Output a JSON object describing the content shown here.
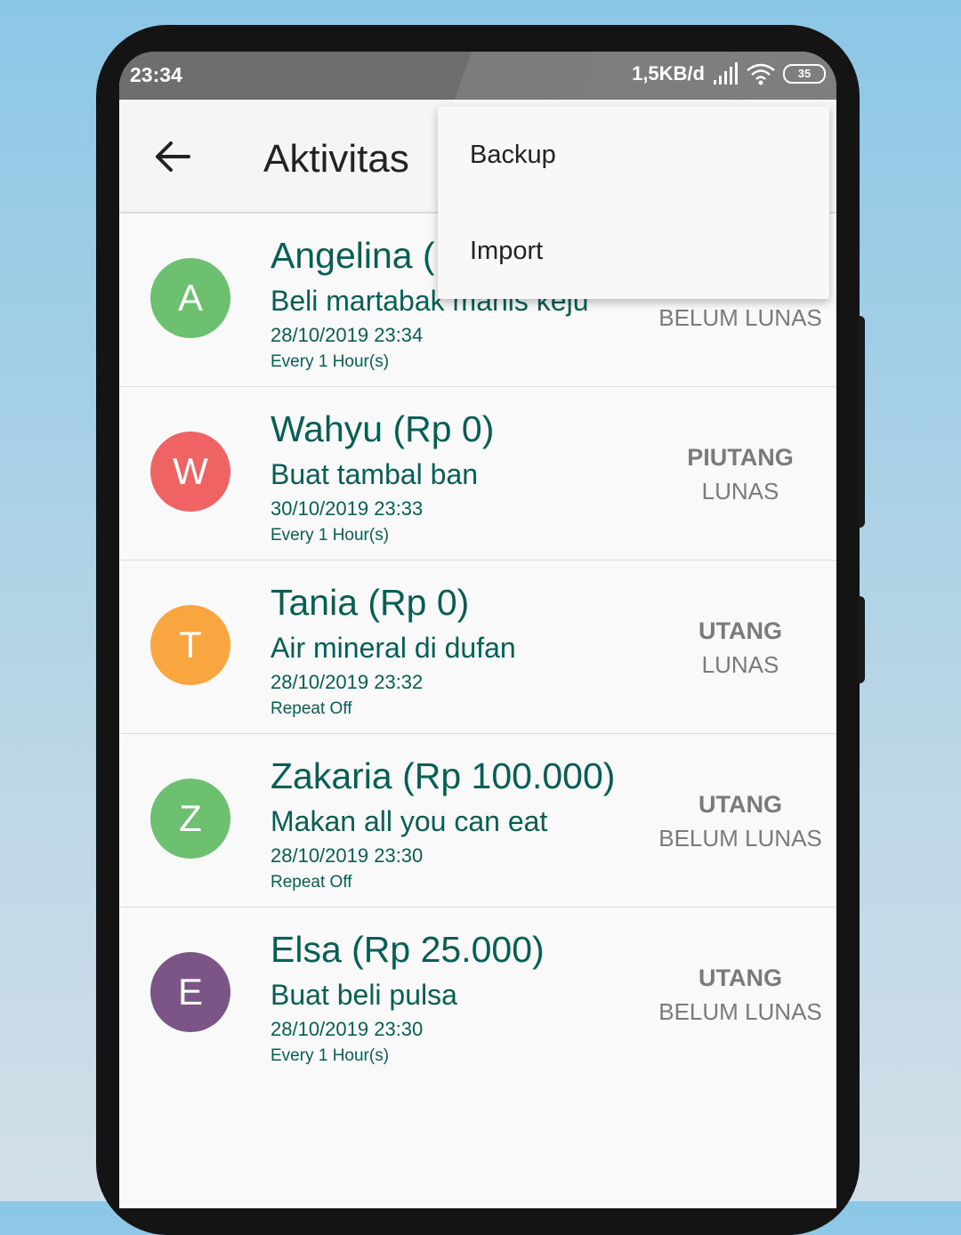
{
  "status_bar": {
    "time": "23:34",
    "network_speed": "1,5KB/d",
    "battery": "35"
  },
  "appbar": {
    "title": "Aktivitas",
    "back_icon": "arrow-left-icon"
  },
  "menu": {
    "items": [
      {
        "label": "Backup"
      },
      {
        "label": "Import"
      }
    ]
  },
  "list": {
    "items": [
      {
        "initial": "A",
        "color": "#6cc070",
        "name": "Angelina (Rp 0)",
        "description": "Beli martabak manis keju",
        "date": "28/10/2019 23:34",
        "repeat": "Every 1 Hour(s)",
        "type": "",
        "status": "BELUM LUNAS"
      },
      {
        "initial": "W",
        "color": "#f06365",
        "name": "Wahyu (Rp 0)",
        "description": "Buat tambal ban",
        "date": "30/10/2019 23:33",
        "repeat": "Every 1 Hour(s)",
        "type": "PIUTANG",
        "status": "LUNAS"
      },
      {
        "initial": "T",
        "color": "#f9a640",
        "name": "Tania (Rp 0)",
        "description": "Air mineral di dufan",
        "date": "28/10/2019 23:32",
        "repeat": "Repeat Off",
        "type": "UTANG",
        "status": "LUNAS"
      },
      {
        "initial": "Z",
        "color": "#6cc070",
        "name": "Zakaria (Rp 100.000)",
        "description": "Makan all you can eat",
        "date": "28/10/2019 23:30",
        "repeat": "Repeat Off",
        "type": "UTANG",
        "status": "BELUM LUNAS"
      },
      {
        "initial": "E",
        "color": "#7b5585",
        "name": "Elsa (Rp 25.000)",
        "description": "Buat beli pulsa",
        "date": "28/10/2019 23:30",
        "repeat": "Every 1 Hour(s)",
        "type": "UTANG",
        "status": "BELUM LUNAS"
      }
    ]
  }
}
